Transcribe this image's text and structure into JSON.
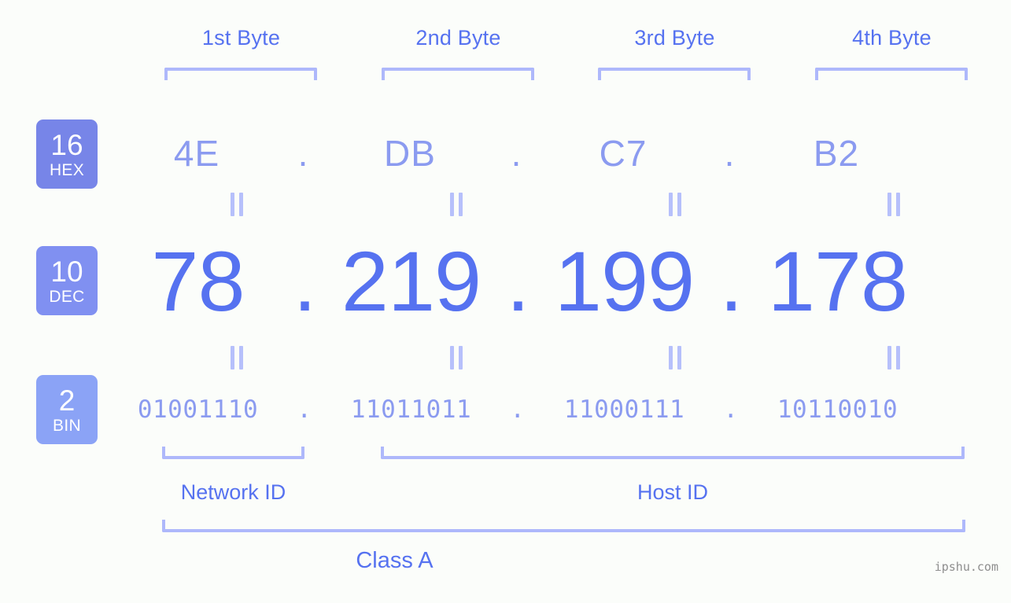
{
  "page": {
    "background_color": "#fbfdfa",
    "accent_color": "#5672f0",
    "light_accent_color": "#8b9bf0",
    "bracket_color": "#aeb8fb",
    "watermark": "ipshu.com"
  },
  "byte_headers": [
    {
      "label": "1st Byte"
    },
    {
      "label": "2nd Byte"
    },
    {
      "label": "3rd Byte"
    },
    {
      "label": "4th Byte"
    }
  ],
  "bases": [
    {
      "number": "16",
      "name": "HEX",
      "color": "#7785e8"
    },
    {
      "number": "10",
      "name": "DEC",
      "color": "#8090f1"
    },
    {
      "number": "2",
      "name": "BIN",
      "color": "#8ba3f6"
    }
  ],
  "rows": {
    "hex": {
      "octets": [
        "4E",
        "DB",
        "C7",
        "B2"
      ],
      "separator": "."
    },
    "dec": {
      "octets": [
        "78",
        "219",
        "199",
        "178"
      ],
      "separator": "."
    },
    "bin": {
      "octets": [
        "01001110",
        "11011011",
        "11000111",
        "10110010"
      ],
      "separator": "."
    }
  },
  "equals_marker": "=",
  "segments": {
    "network_id": "Network ID",
    "host_id": "Host ID",
    "class": "Class A"
  }
}
